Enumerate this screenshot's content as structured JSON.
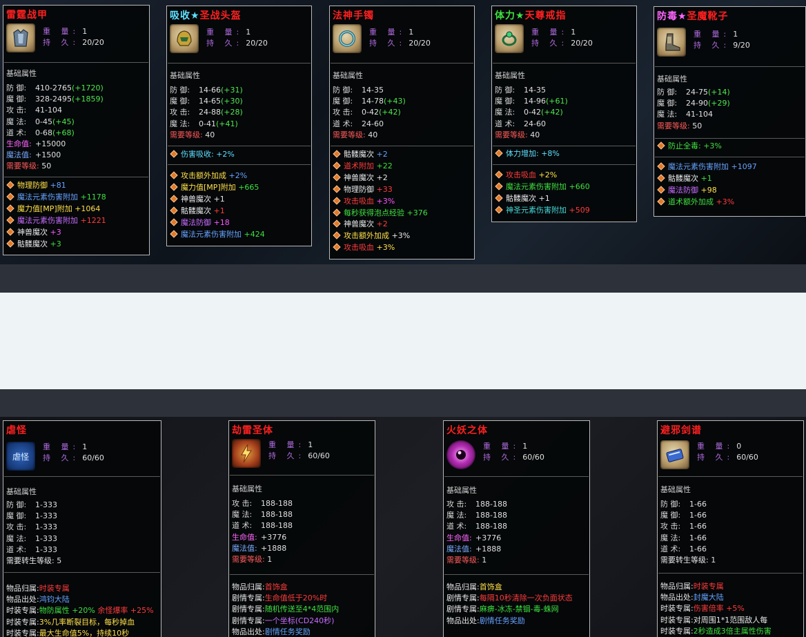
{
  "top_cards": [
    {
      "title": "雷霆战甲",
      "weight_label": "重 量:",
      "weight": "1",
      "durability_label": "持 久:",
      "durability": "20/20",
      "base_title": "基础属性",
      "base": [
        {
          "k": "防 御:",
          "v": "410-2765",
          "b": "(+1720)"
        },
        {
          "k": "魔 御:",
          "v": "328-2495",
          "b": "(+1859)"
        },
        {
          "k": "攻 击:",
          "v": "41-104",
          "b": ""
        },
        {
          "k": "魔 法:",
          "v": "0-45",
          "b": "(+45)"
        },
        {
          "k": "道 术:",
          "v": "0-68",
          "b": "(+68)"
        },
        {
          "k": "生命值:",
          "v": "+15000",
          "b": ""
        },
        {
          "k": "魔法值:",
          "v": "+1500",
          "b": ""
        },
        {
          "k": "需要等级:",
          "v": "50",
          "b": ""
        }
      ],
      "props": [
        {
          "n": "物理防御",
          "v": "+81"
        },
        {
          "n": "魔法元素伤害附加",
          "v": "+1178"
        },
        {
          "n": "魔力值[MP]附加",
          "v": "+1064"
        },
        {
          "n": "魔法元素伤害附加",
          "v": "+1221"
        },
        {
          "n": "神兽魔次",
          "v": "+3"
        },
        {
          "n": "骷髅魔次",
          "v": "+3"
        }
      ]
    },
    {
      "title_a": "吸收",
      "title_star": "★",
      "title_b": "圣战头盔",
      "weight_label": "重 量:",
      "weight": "1",
      "durability_label": "持 久:",
      "durability": "20/20",
      "base_title": "基础属性",
      "base": [
        {
          "k": "防 御:",
          "v": "14-66",
          "b": "(+31)"
        },
        {
          "k": "魔 御:",
          "v": "14-65",
          "b": "(+30)"
        },
        {
          "k": "攻 击:",
          "v": "24-88",
          "b": "(+28)"
        },
        {
          "k": "魔 法:",
          "v": "0-41",
          "b": "(+41)"
        },
        {
          "k": "需要等级:",
          "v": "40",
          "b": ""
        }
      ],
      "special": {
        "n": "伤害吸收:",
        "v": "+2%"
      },
      "props": [
        {
          "n": "攻击额外加成",
          "v": "+2%"
        },
        {
          "n": "魔力值[MP]附加",
          "v": "+665"
        },
        {
          "n": "神兽魔次",
          "v": "+1"
        },
        {
          "n": "骷髅魔次",
          "v": "+1"
        },
        {
          "n": "魔法防御",
          "v": "+18"
        },
        {
          "n": "魔法元素伤害附加",
          "v": "+424"
        }
      ]
    },
    {
      "title": "法神手镯",
      "weight_label": "重 量:",
      "weight": "1",
      "durability_label": "持 久:",
      "durability": "20/20",
      "base_title": "基础属性",
      "base": [
        {
          "k": "防 御:",
          "v": "14-35",
          "b": ""
        },
        {
          "k": "魔 御:",
          "v": "14-78",
          "b": "(+43)"
        },
        {
          "k": "攻 击:",
          "v": "0-42",
          "b": "(+42)"
        },
        {
          "k": "道 术:",
          "v": "24-60",
          "b": ""
        },
        {
          "k": "需要等级:",
          "v": "40",
          "b": ""
        }
      ],
      "props": [
        {
          "n": "骷髅魔次",
          "v": "+2"
        },
        {
          "n": "道术附加",
          "v": "+22"
        },
        {
          "n": "神兽魔次",
          "v": "+2"
        },
        {
          "n": "物理防御",
          "v": "+33"
        },
        {
          "n": "攻击吸血",
          "v": "+3%"
        },
        {
          "n": "每秒获得泡点经验",
          "v": "+376"
        },
        {
          "n": "神兽魔次",
          "v": "+2"
        },
        {
          "n": "攻击额外加成",
          "v": "+3%"
        },
        {
          "n": "攻击吸血",
          "v": "+3%"
        }
      ]
    },
    {
      "title_a": "体力",
      "title_star": "★",
      "title_b": "天尊戒指",
      "weight_label": "重 量:",
      "weight": "1",
      "durability_label": "持 久:",
      "durability": "20/20",
      "base_title": "基础属性",
      "base": [
        {
          "k": "防 御:",
          "v": "14-35",
          "b": ""
        },
        {
          "k": "魔 御:",
          "v": "14-96",
          "b": "(+61)"
        },
        {
          "k": "魔 法:",
          "v": "0-42",
          "b": "(+42)"
        },
        {
          "k": "道 术:",
          "v": "24-60",
          "b": ""
        },
        {
          "k": "需要等级:",
          "v": "40",
          "b": ""
        }
      ],
      "special": {
        "n": "体力增加:",
        "v": "+8%"
      },
      "props": [
        {
          "n": "攻击吸血",
          "v": "+2%"
        },
        {
          "n": "魔法元素伤害附加",
          "v": "+660"
        },
        {
          "n": "骷髅魔次",
          "v": "+1"
        },
        {
          "n": "神圣元素伤害附加",
          "v": "+509"
        }
      ]
    },
    {
      "title_a": "防毒",
      "title_star": "★",
      "title_b": "圣魔靴子",
      "weight_label": "重 量:",
      "weight": "1",
      "durability_label": "持 久:",
      "durability": "9/20",
      "base_title": "基础属性",
      "base": [
        {
          "k": "防 御:",
          "v": "24-75",
          "b": "(+14)"
        },
        {
          "k": "魔 御:",
          "v": "24-90",
          "b": "(+29)"
        },
        {
          "k": "魔 法:",
          "v": "41-104",
          "b": ""
        },
        {
          "k": "需要等级:",
          "v": "50",
          "b": ""
        }
      ],
      "special": {
        "n": "防止全毒:",
        "v": "+3%"
      },
      "props": [
        {
          "n": "魔法元素伤害附加",
          "v": "+1097"
        },
        {
          "n": "骷髅魔次",
          "v": "+1"
        },
        {
          "n": "魔法防御",
          "v": "+98"
        },
        {
          "n": "道术额外加成",
          "v": "+3%"
        }
      ]
    }
  ],
  "bottom_cards": [
    {
      "title": "虐怪",
      "weight_label": "重 量:",
      "weight": "1",
      "durability_label": "持 久:",
      "durability": "60/60",
      "base_title": "基础属性",
      "base": [
        {
          "k": "防 御:",
          "v": "1-333"
        },
        {
          "k": "魔 御:",
          "v": "1-333"
        },
        {
          "k": "攻 击:",
          "v": "1-333"
        },
        {
          "k": "魔 法:",
          "v": "1-333"
        },
        {
          "k": "道 术:",
          "v": "1-333"
        },
        {
          "k": "需要转生等级:",
          "v": "5"
        }
      ],
      "info": [
        {
          "k": "物品归属:",
          "v": "时装专属",
          "v2": ""
        },
        {
          "k": "物品出处:",
          "v": "鸿钧大陆",
          "v2": ""
        },
        {
          "k": "时装专属:",
          "v": "物防属性 +20%",
          "v2": "余怪爆率 +25%"
        },
        {
          "k": "时装专属:",
          "v": "3%几率断裂目标，每秒掉血",
          "v2": ""
        },
        {
          "k": "时装专属:",
          "v": "最大生命值5%，持续10秒",
          "v2": ""
        }
      ]
    },
    {
      "title": "劫雷圣体",
      "weight_label": "重 量:",
      "weight": "1",
      "durability_label": "持 久:",
      "durability": "60/60",
      "base_title": "基础属性",
      "base": [
        {
          "k": "攻 击:",
          "v": "188-188"
        },
        {
          "k": "魔 法:",
          "v": "188-188"
        },
        {
          "k": "道 术:",
          "v": "188-188"
        },
        {
          "k": "生命值:",
          "v": "+3776"
        },
        {
          "k": "魔法值:",
          "v": "+1888"
        },
        {
          "k": "需要等级:",
          "v": "1"
        }
      ],
      "info": [
        {
          "k": "物品归属:",
          "v": "首饰盒"
        },
        {
          "k": "剧情专属:",
          "v": "生命值低于20%时"
        },
        {
          "k": "剧情专属:",
          "v": "随机传送至4*4范围内"
        },
        {
          "k": "剧情专属:",
          "v": "一个坐标(CD240秒)"
        },
        {
          "k": "物品出处:",
          "v": "剧情任务奖励"
        }
      ]
    },
    {
      "title": "火妖之体",
      "weight_label": "重 量:",
      "weight": "1",
      "durability_label": "持 久:",
      "durability": "60/60",
      "base_title": "基础属性",
      "base": [
        {
          "k": "攻 击:",
          "v": "188-188"
        },
        {
          "k": "魔 法:",
          "v": "188-188"
        },
        {
          "k": "道 术:",
          "v": "188-188"
        },
        {
          "k": "生命值:",
          "v": "+3776"
        },
        {
          "k": "魔法值:",
          "v": "+1888"
        },
        {
          "k": "需要等级:",
          "v": "1"
        }
      ],
      "info": [
        {
          "k": "物品归属:",
          "v": "首饰盒"
        },
        {
          "k": "剧情专属:",
          "v": "每隔10秒清除一次负面状态"
        },
        {
          "k": "剧情专属:",
          "v": "麻痹-冰冻-禁锢-毒-蛛网"
        },
        {
          "k": "物品出处:",
          "v": "剧情任务奖励"
        }
      ]
    },
    {
      "title": "避邪剑谱",
      "weight_label": "重 量:",
      "weight": "0",
      "durability_label": "持 久:",
      "durability": "60/60",
      "base_title": "基础属性",
      "base": [
        {
          "k": "防 御:",
          "v": "1-66"
        },
        {
          "k": "魔 御:",
          "v": "1-66"
        },
        {
          "k": "攻 击:",
          "v": "1-66"
        },
        {
          "k": "魔 法:",
          "v": "1-66"
        },
        {
          "k": "道 术:",
          "v": "1-66"
        },
        {
          "k": "需要转生等级:",
          "v": "1"
        }
      ],
      "info": [
        {
          "k": "物品归属:",
          "v": "时装专属"
        },
        {
          "k": "物品出处:",
          "v": "封魔大陆"
        },
        {
          "k": "时装专属:",
          "v": "伤害倍率 +5%"
        },
        {
          "k": "时装专属:",
          "v": "对周围1*1范围敌人每"
        },
        {
          "k": "时装专属:",
          "v": "2秒造成3倍主属性伤害"
        }
      ]
    }
  ]
}
